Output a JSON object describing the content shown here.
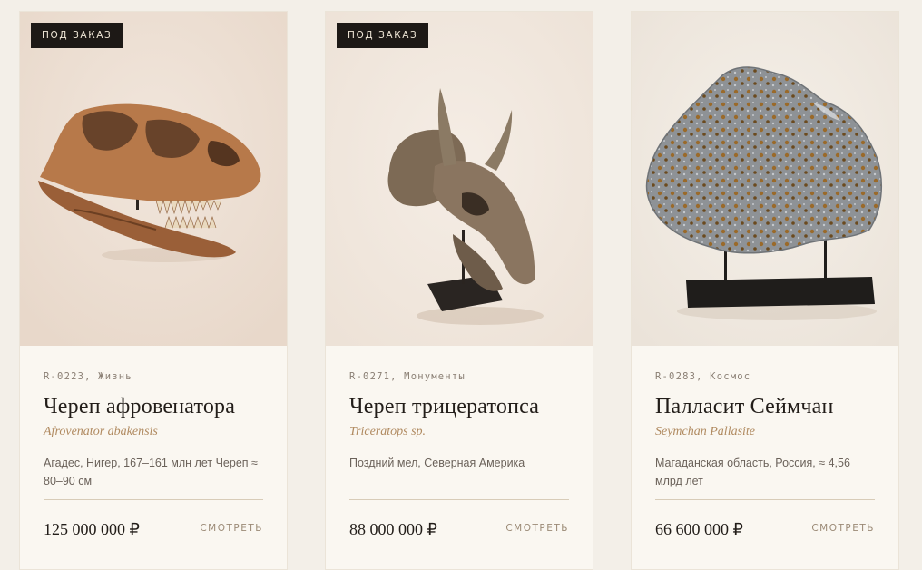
{
  "products": [
    {
      "badge": "ПОД ЗАКАЗ",
      "meta": "R-0223, Жизнь",
      "title": "Череп афровенатора",
      "latin": "Afrovenator abakensis",
      "desc": "Агадес, Нигер, 167–161 млн лет Череп ≈ 80–90 см",
      "price": "125 000 000 ₽",
      "cta": "СМОТРЕТЬ"
    },
    {
      "badge": "ПОД ЗАКАЗ",
      "meta": "R-0271, Монументы",
      "title": "Череп трицератопса",
      "latin": "Triceratops sp.",
      "desc": "Поздний мел, Северная Америка",
      "price": "88 000 000 ₽",
      "cta": "СМОТРЕТЬ"
    },
    {
      "meta": "R-0283, Космос",
      "title": "Палласит Сеймчан",
      "latin": "Seymchan Pallasite",
      "desc": "Магаданская область, Россия, ≈ 4,56 млрд лет",
      "price": "66 600 000 ₽",
      "cta": "СМОТРЕТЬ"
    }
  ],
  "colors": {
    "page_bg": "#f3efe8",
    "card_bg": "#faf7f1",
    "badge_bg": "#1d1916",
    "accent_latin": "#b08a60"
  },
  "icons": [
    "dinosaur-skull-image",
    "triceratops-skull-image",
    "pallasite-meteorite-image"
  ]
}
